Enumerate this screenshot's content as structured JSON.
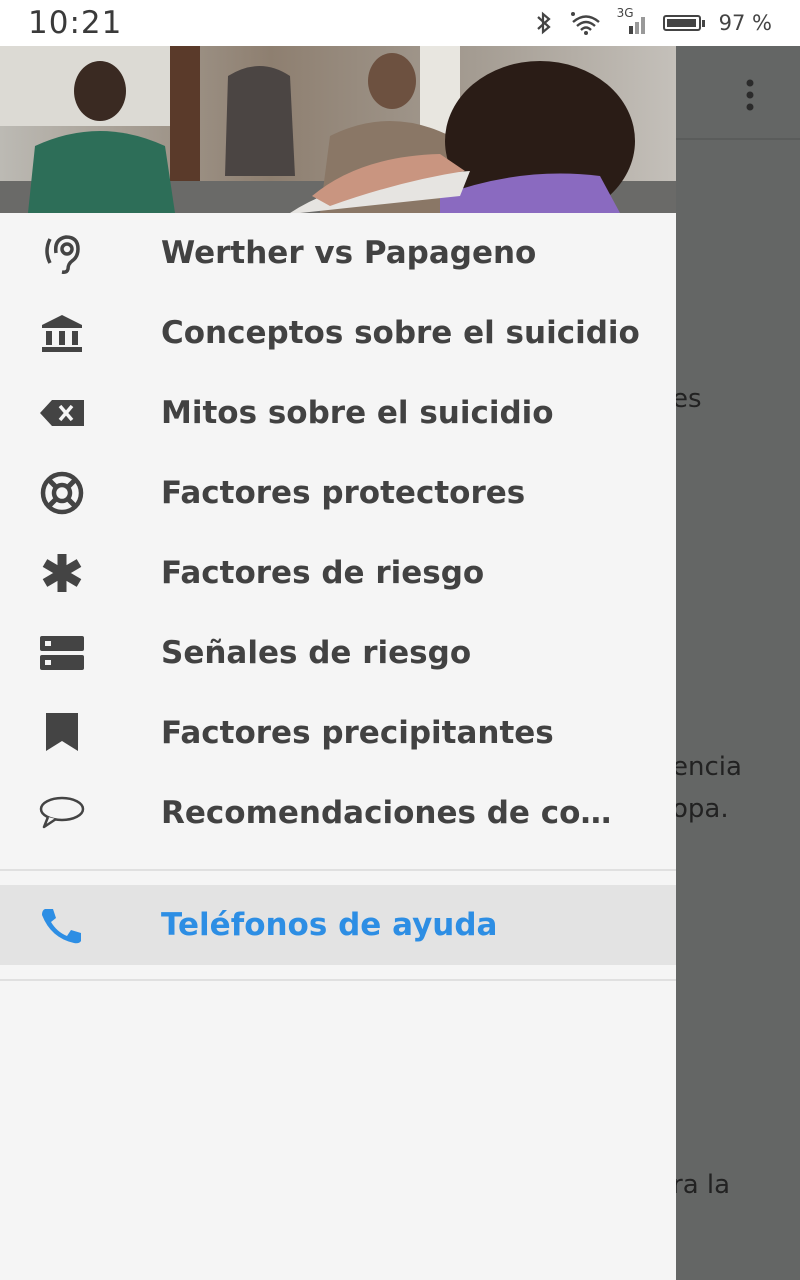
{
  "status_bar": {
    "time": "10:21",
    "battery_percent": "97 %",
    "network_type": "3G",
    "icons": [
      "bluetooth-icon",
      "wifi-icon",
      "signal-icon",
      "battery-icon"
    ]
  },
  "background_page": {
    "fragments": [
      "es",
      "encia",
      "opa.",
      "ra la"
    ]
  },
  "drawer": {
    "menu_items": [
      {
        "label": "Werther vs Papageno",
        "icon": "hearing-ear-icon"
      },
      {
        "label": "Conceptos sobre el suicidio",
        "icon": "bank-building-icon"
      },
      {
        "label": "Mitos sobre el suicidio",
        "icon": "backspace-x-icon"
      },
      {
        "label": "Factores protectores",
        "icon": "lifebuoy-icon"
      },
      {
        "label": "Factores de riesgo",
        "icon": "asterisk-icon"
      },
      {
        "label": "Señales de riesgo",
        "icon": "storage-icon"
      },
      {
        "label": "Factores precipitantes",
        "icon": "bookmark-icon"
      },
      {
        "label": "Recomendaciones de comunicación",
        "icon": "chat-bubble-icon"
      }
    ],
    "help_item": {
      "label": "Teléfonos de ayuda",
      "icon": "phone-icon",
      "selected": true
    }
  },
  "colors": {
    "accent": "#2d8ee4",
    "drawer_bg": "#f5f5f5",
    "scrim": "#646665",
    "selected_bg": "#e3e3e3",
    "text": "#424242"
  }
}
